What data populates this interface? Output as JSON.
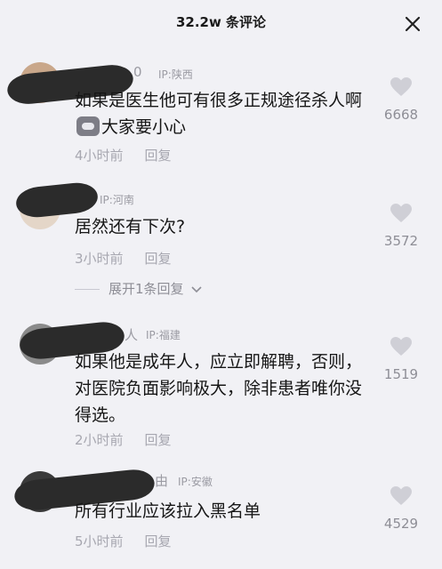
{
  "header": {
    "title": "32.2w 条评论",
    "close_icon": "close-icon"
  },
  "comments": [
    {
      "name_tail": "0",
      "ip": "IP:陕西",
      "text_before_emoji": "如果是医生他可有很多正规途径杀人啊",
      "text_after_emoji": "大家要小心",
      "time": "4小时前",
      "reply_label": "回复",
      "likes": "6668"
    },
    {
      "name_tail": "",
      "ip": "IP:河南",
      "text": "居然还有下次?",
      "time": "3小时前",
      "reply_label": "回复",
      "likes": "3572"
    },
    {
      "name_tail": "人",
      "ip": "IP:福建",
      "text": "如果他是成年人，应立即解聘，否则，对医院负面影响极大，除非患者唯你没得选。",
      "time": "2小时前",
      "reply_label": "回复",
      "likes": "1519"
    },
    {
      "name_tail": "由",
      "ip": "IP:安徽",
      "text": "所有行业应该拉入黑名单",
      "time": "5小时前",
      "reply_label": "回复",
      "likes": "4529"
    }
  ],
  "expand_replies": "展开1条回复"
}
